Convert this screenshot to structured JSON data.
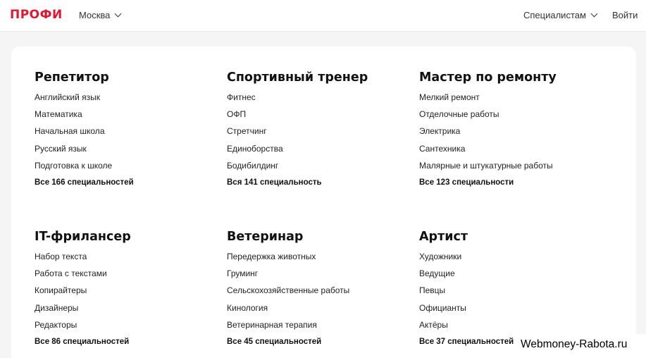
{
  "header": {
    "logo": "ПРОФИ",
    "city": "Москва",
    "specialists": "Специалистам",
    "login": "Войти"
  },
  "categories": [
    {
      "title": "Репетитор",
      "items": [
        "Английский язык",
        "Математика",
        "Начальная школа",
        "Русский язык",
        "Подготовка к школе"
      ],
      "all": "Все 166 специальностей"
    },
    {
      "title": "Спортивный тренер",
      "items": [
        "Фитнес",
        "ОФП",
        "Стретчинг",
        "Единоборства",
        "Бодибилдинг"
      ],
      "all": "Вся 141 специальность"
    },
    {
      "title": "Мастер по ремонту",
      "items": [
        "Мелкий ремонт",
        "Отделочные работы",
        "Электрика",
        "Сантехника",
        "Малярные и штукатурные работы"
      ],
      "all": "Все 123 специальности"
    },
    {
      "title": "IT-фрилансер",
      "items": [
        "Набор текста",
        "Работа с текстами",
        "Копирайтеры",
        "Дизайнеры",
        "Редакторы"
      ],
      "all": "Все 86 специальностей"
    },
    {
      "title": "Ветеринар",
      "items": [
        "Передержка животных",
        "Груминг",
        "Сельскохозяйственные работы",
        "Кинология",
        "Ветеринарная терапия"
      ],
      "all": "Все 45 специальностей"
    },
    {
      "title": "Артист",
      "items": [
        "Художники",
        "Ведущие",
        "Певцы",
        "Официанты",
        "Актёры"
      ],
      "all": "Все 37 специальностей"
    }
  ],
  "watermark": "Webmoney-Rabota.ru",
  "colors": {
    "brand": "#e2162f",
    "background": "#f5f5f5",
    "card": "#ffffff"
  }
}
